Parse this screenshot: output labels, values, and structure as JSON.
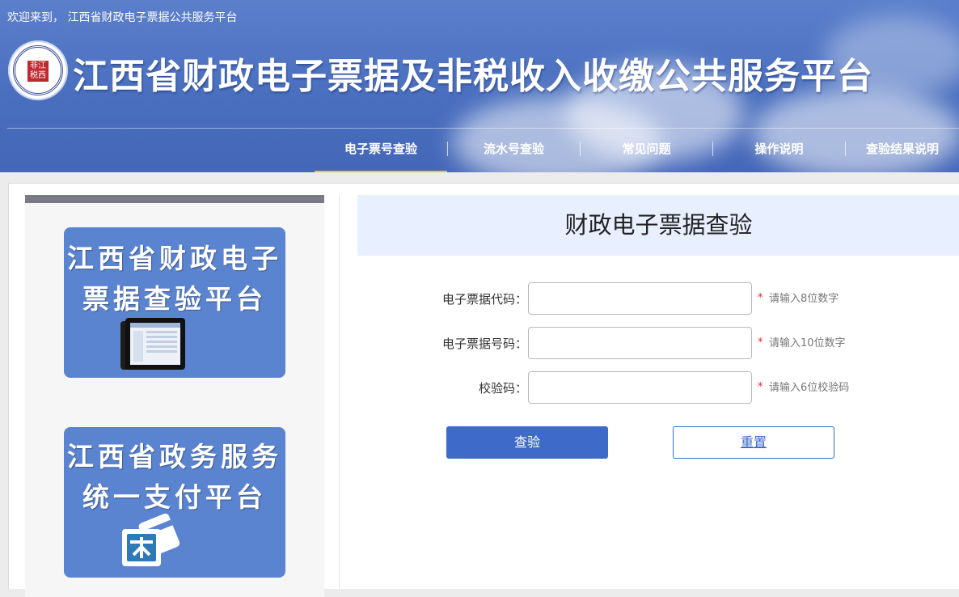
{
  "header": {
    "welcome": "欢迎来到， 江西省财政电子票据公共服务平台",
    "title": "江西省财政电子票据及非税收入收缴公共服务平台",
    "seal_text": "非江 税西",
    "seal_icon": "jiangxi-nontax-seal-logo",
    "nav": [
      {
        "label": "电子票号查验",
        "active": true
      },
      {
        "label": "流水号查验",
        "active": false
      },
      {
        "label": "常见问题",
        "active": false
      },
      {
        "label": "操作说明",
        "active": false
      },
      {
        "label": "查验结果说明",
        "active": false
      }
    ],
    "colors": {
      "header_bg": "#4a6fbf",
      "active_underline": "#f0c419"
    }
  },
  "sidebar": {
    "cards": [
      {
        "line1": "江西省财政电子",
        "line2": "票据查验平台",
        "icon": "tablet-screen-icon"
      },
      {
        "line1": "江西省政务服务",
        "line2": "统一支付平台",
        "icon": "payment-card-icon"
      }
    ]
  },
  "form": {
    "title": "财政电子票据查验",
    "fields": [
      {
        "label": "电子票据代码：",
        "value": "",
        "placeholder": "",
        "required_mark": "*",
        "hint": "请输入8位数字"
      },
      {
        "label": "电子票据号码：",
        "value": "",
        "placeholder": "",
        "required_mark": "*",
        "hint": "请输入10位数字"
      },
      {
        "label": "校验码：",
        "value": "",
        "placeholder": "",
        "required_mark": "*",
        "hint": "请输入6位校验码"
      }
    ],
    "submit_label": "查验",
    "reset_label": "重置",
    "colors": {
      "primary": "#3e6bc9",
      "form_head_bg": "#e8efff"
    }
  }
}
